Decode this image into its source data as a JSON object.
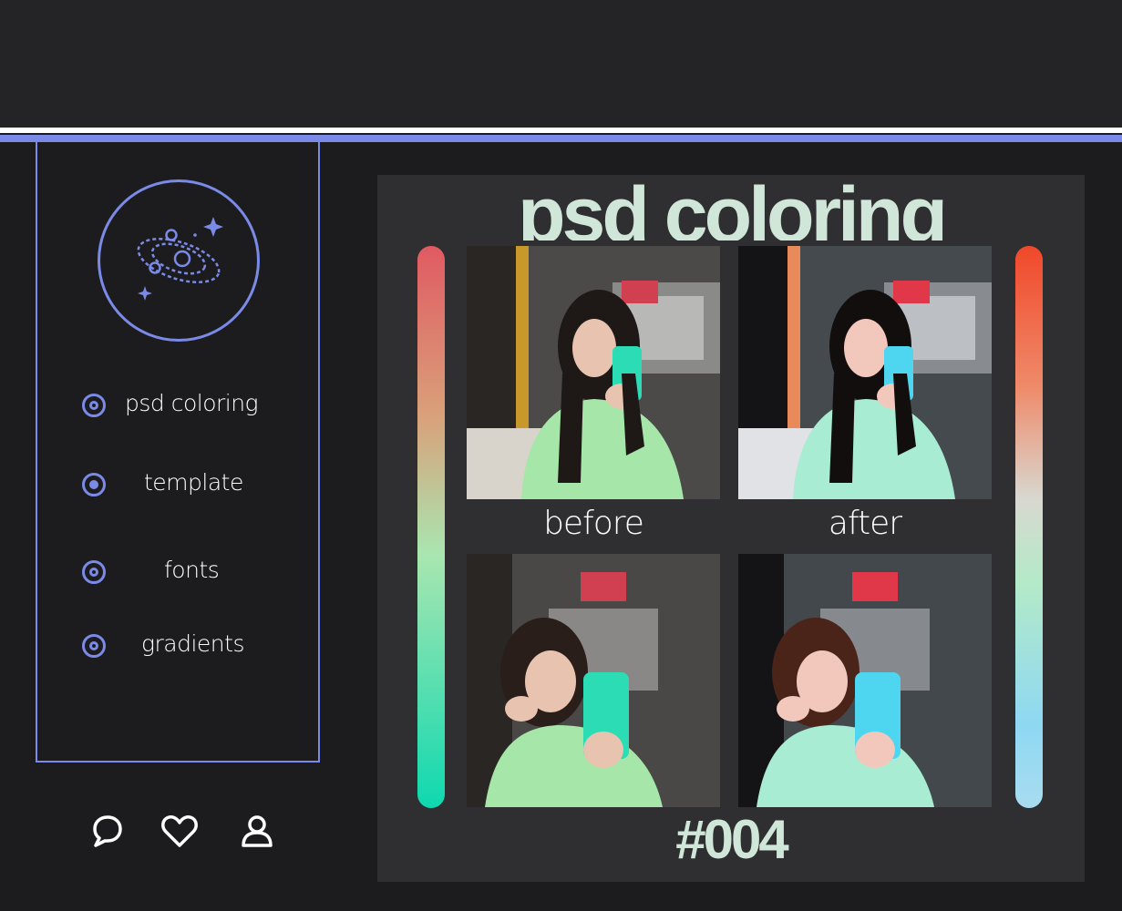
{
  "colors": {
    "accent": "#7b8ae6",
    "background": "#1c1c1e",
    "panel": "#2f2f31",
    "title": "#cfe6d8"
  },
  "avatar": {
    "icon": "galaxy-planet-icon"
  },
  "nav": [
    {
      "label": "psd coloring",
      "icon": "radio-icon",
      "selected": false
    },
    {
      "label": "template",
      "icon": "radio-icon",
      "selected": true
    },
    {
      "label": "fonts",
      "icon": "radio-icon",
      "selected": false
    },
    {
      "label": "gradients",
      "icon": "radio-icon",
      "selected": false
    }
  ],
  "actions": [
    {
      "icon": "comment-icon"
    },
    {
      "icon": "heart-icon"
    },
    {
      "icon": "user-icon"
    }
  ],
  "panel": {
    "title": "psd coloring",
    "before_label": "before",
    "after_label": "after",
    "number": "#004"
  }
}
